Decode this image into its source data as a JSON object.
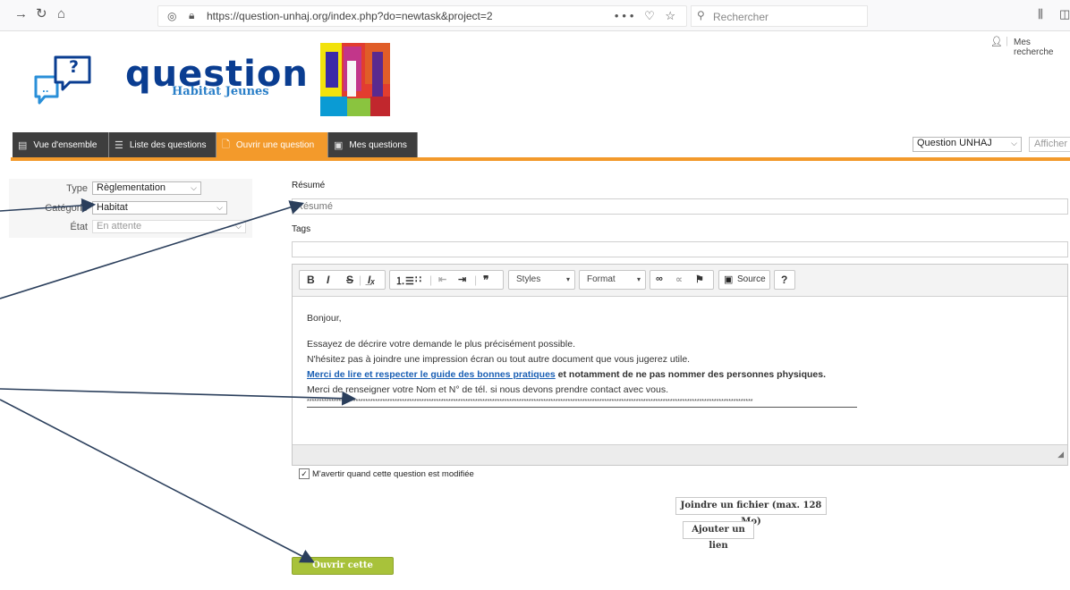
{
  "browser": {
    "url": "https://question-unhaj.org/index.php?do=newtask&project=2",
    "search_placeholder": "Rechercher",
    "page_actions": "••• ♡ ☆"
  },
  "header": {
    "logo_word": "question",
    "logo_sub": "Habitat Jeunes",
    "logo_bubble": "?",
    "user_link": "Mes recherche"
  },
  "tabs": [
    {
      "label": "Vue d'ensemble",
      "icon": "calendar-icon"
    },
    {
      "label": "Liste des questions",
      "icon": "list-icon"
    },
    {
      "label": "Ouvrir une question",
      "icon": "document-icon"
    },
    {
      "label": "Mes questions",
      "icon": "folder-icon"
    }
  ],
  "project_select": {
    "value": "Question UNHAJ"
  },
  "show_button": "Afficher",
  "fields": {
    "type_label": "Type",
    "type_value": "Règlementation",
    "category_label": "Catégorie",
    "category_value": "Habitat",
    "state_label": "État",
    "state_value": "En attente"
  },
  "summary": {
    "label": "Résumé",
    "placeholder": "Résumé"
  },
  "tags": {
    "label": "Tags"
  },
  "editor": {
    "styles_combo": "Styles",
    "format_combo": "Format",
    "source_label": "Source",
    "greeting": "Bonjour,",
    "line1": "Essayez de décrire votre demande le plus précisément possible.",
    "line2": "N'hésitez pas à joindre une impression écran ou tout autre document que vous jugerez utile.",
    "link_text": "Merci de lire et respecter le guide des bonnes pratiques",
    "bold_text": " et notamment de ne pas nommer des personnes physiques.",
    "line4": "Merci de renseigner votre Nom et N° de tél. si nous devons prendre contact avec vous.",
    "stars": "***************************************************************************************************************************************************************************************"
  },
  "notify_label": "M'avertir quand cette question est modifiée",
  "attach_button": "Joindre un fichier (max. 128 Mo)",
  "add_link_button": "Ajouter un lien",
  "submit_button": "Ouvrir cette question",
  "colors": {
    "tab_bg": "#3e3e3e",
    "tab_active": "#f39a2b",
    "submit": "#a8c23a",
    "logo": "#0a3d91",
    "arrow": "#2b3f5c"
  }
}
